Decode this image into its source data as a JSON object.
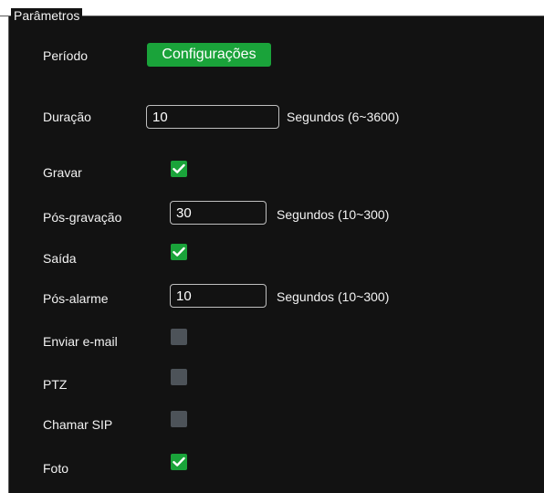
{
  "group": {
    "legend": "Parâmetros"
  },
  "periodo": {
    "label": "Período",
    "button_label": "Configurações"
  },
  "duracao": {
    "label": "Duração",
    "value": "10",
    "unit": "Segundos (6~3600)"
  },
  "gravar": {
    "label": "Gravar",
    "checked": true
  },
  "pos_gravacao": {
    "label": "Pós-gravação",
    "value": "30",
    "unit": "Segundos (10~300)"
  },
  "saida": {
    "label": "Saída",
    "checked": true
  },
  "pos_alarme": {
    "label": "Pós-alarme",
    "value": "10",
    "unit": "Segundos (10~300)"
  },
  "enviar_email": {
    "label": "Enviar e-mail",
    "checked": false
  },
  "ptz": {
    "label": "PTZ",
    "checked": false
  },
  "chamar_sip": {
    "label": "Chamar SIP",
    "checked": false
  },
  "foto": {
    "label": "Foto",
    "checked": true
  },
  "colors": {
    "accent_green": "#1aa33a",
    "checkbox_off": "#4d5359",
    "panel_bg": "#121212"
  }
}
